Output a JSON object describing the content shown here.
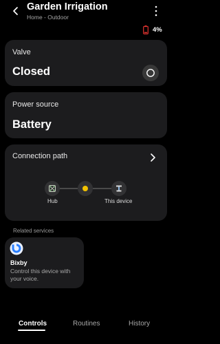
{
  "header": {
    "title": "Garden Irrigation",
    "subtitle": "Home - Outdoor",
    "battery_level": "4%",
    "battery_color": "#e0332f"
  },
  "valve": {
    "label": "Valve",
    "state": "Closed"
  },
  "power": {
    "label": "Power source",
    "value": "Battery"
  },
  "connection": {
    "label": "Connection path",
    "nodes": [
      {
        "label": "Hub",
        "icon": "hub-icon"
      },
      {
        "label": "",
        "icon": "relay-dot-icon",
        "color": "#f2c200"
      },
      {
        "label": "This device",
        "icon": "valve-device-icon"
      }
    ]
  },
  "related": {
    "heading": "Related services",
    "services": [
      {
        "title": "Bixby",
        "description": "Control this device with your voice.",
        "icon": "bixby-icon",
        "color": "#2a7fff"
      }
    ]
  },
  "tabs": [
    {
      "label": "Controls",
      "active": true
    },
    {
      "label": "Routines",
      "active": false
    },
    {
      "label": "History",
      "active": false
    }
  ]
}
